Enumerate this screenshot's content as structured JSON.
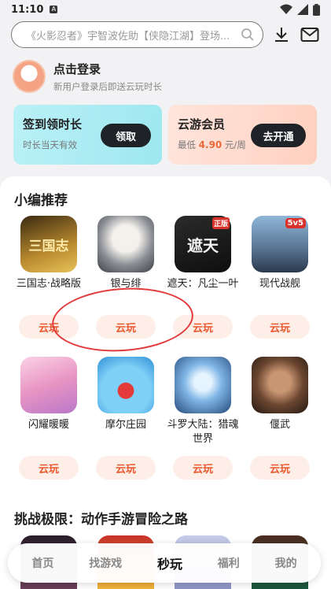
{
  "status": {
    "time": "11:10",
    "sim_badge": "A"
  },
  "search": {
    "placeholder": "《火影忍者》宇智波佐助【侠隐江湖】登场..."
  },
  "login": {
    "title": "点击登录",
    "subtitle": "新用户登录后即送云玩时长"
  },
  "promos": [
    {
      "title": "签到领时长",
      "subtitle": "时长当天有效",
      "button": "领取"
    },
    {
      "title": "云游会员",
      "subtitle_prefix": "最低",
      "price": "4.90",
      "subtitle_suffix": "元/周",
      "button": "去开通"
    }
  ],
  "section1": {
    "title": "小编推荐",
    "games": [
      {
        "name": "三国志·战略版",
        "icon_label": "三国志",
        "play": "云玩"
      },
      {
        "name": "银与绯",
        "icon_label": "",
        "play": "云玩"
      },
      {
        "name": "遮天：凡尘一叶",
        "icon_label": "遮天",
        "play": "云玩"
      },
      {
        "name": "现代战舰",
        "icon_label": "5v5",
        "play": "云玩"
      },
      {
        "name": "闪耀暖暖",
        "icon_label": "",
        "play": "云玩"
      },
      {
        "name": "摩尔庄园",
        "icon_label": "",
        "play": "云玩"
      },
      {
        "name": "斗罗大陆：猎魂世界",
        "icon_label": "",
        "play": "云玩"
      },
      {
        "name": "偃武",
        "icon_label": "",
        "play": "云玩"
      }
    ]
  },
  "section2": {
    "title": "挑战极限：动作手游冒险之路"
  },
  "tabbar": {
    "items": [
      "首页",
      "找游戏",
      "秒玩",
      "福利",
      "我的"
    ],
    "active_index": 2
  },
  "colors": {
    "accent": "#e8592f",
    "dark_button": "#1f2328"
  }
}
